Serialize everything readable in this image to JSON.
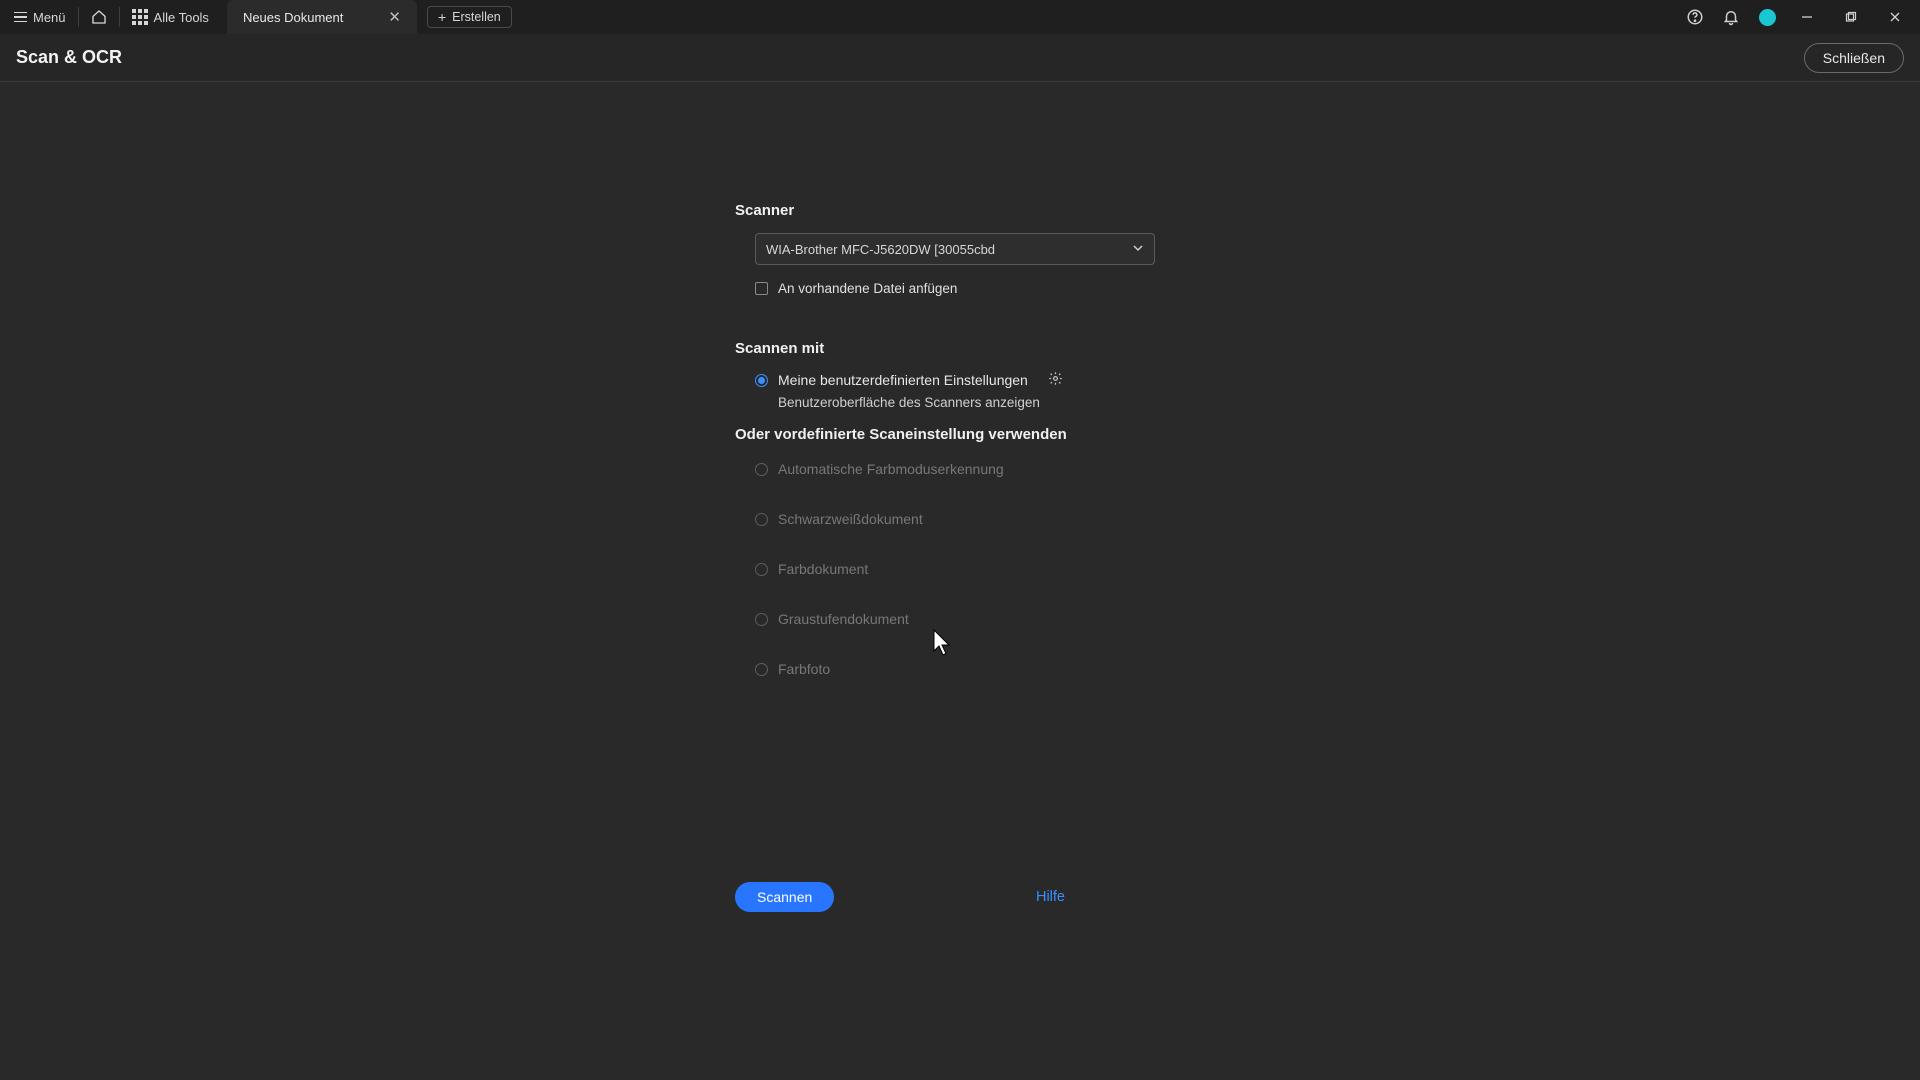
{
  "colors": {
    "accent": "#2876ff",
    "avatar": "#18c7d1"
  },
  "titlebar": {
    "menu_label": "Menü",
    "all_tools_label": "Alle Tools",
    "tab_label": "Neues Dokument",
    "create_label": "Erstellen"
  },
  "toolheader": {
    "title": "Scan & OCR",
    "close_label": "Schließen"
  },
  "form": {
    "scanner_heading": "Scanner",
    "scanner_selected": "WIA-Brother MFC-J5620DW [30055cbd",
    "append_label": "An vorhandene Datei anfügen",
    "scan_with_heading": "Scannen mit",
    "custom_label": "Meine benutzerdefinierten Einstellungen",
    "custom_sub": "Benutzeroberfläche des Scanners anzeigen",
    "preset_heading": "Oder vordefinierte Scaneinstellung verwenden",
    "presets": {
      "p0": "Automatische Farbmoduserkennung",
      "p1": "Schwarzweißdokument",
      "p2": "Farbdokument",
      "p3": "Graustufendokument",
      "p4": "Farbfoto"
    },
    "scan_button": "Scannen",
    "help_link": "Hilfe"
  }
}
